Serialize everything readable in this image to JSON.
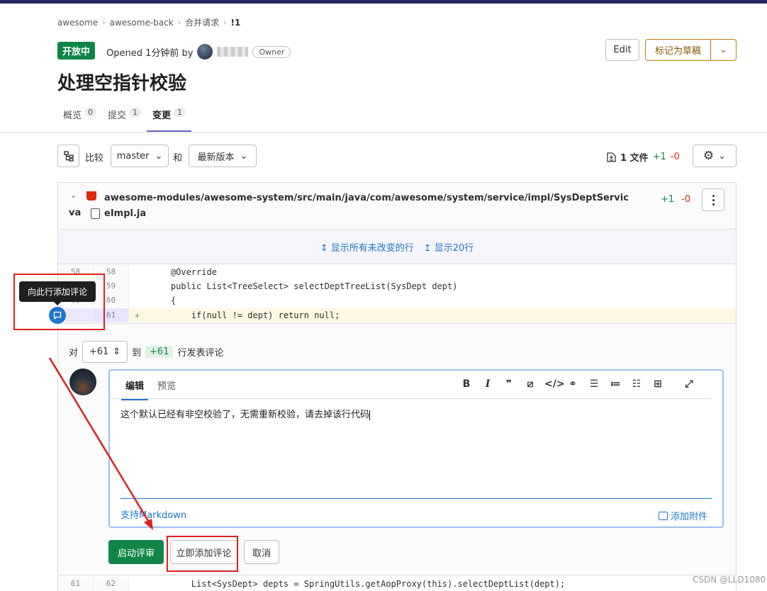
{
  "breadcrumb": [
    "awesome",
    "awesome-back",
    "合并请求",
    "!1"
  ],
  "status": "开放中",
  "opened_text": "Opened 1分钟前 by",
  "owner_badge": "Owner",
  "actions": {
    "edit": "Edit",
    "draft": "标记为草稿"
  },
  "title": "处理空指针校验",
  "tabs": [
    {
      "label": "概览",
      "count": "0"
    },
    {
      "label": "提交",
      "count": "1"
    },
    {
      "label": "变更",
      "count": "1"
    }
  ],
  "compare": {
    "label": "比较",
    "from": "master",
    "and": "和",
    "to": "最新版本"
  },
  "files": {
    "count_text": "1 文件",
    "added": "+1",
    "removed": "-0"
  },
  "file": {
    "path_line1": "awesome-modules/awesome-system/src/main/java/com/awesome/system/service/impl/SysDeptServiceImpl.ja",
    "path_line2": "va",
    "added": "+1",
    "removed": "-0"
  },
  "expand": {
    "all": "显示所有未改变的行",
    "twenty": "显示20行"
  },
  "code_lines": [
    {
      "old": "58",
      "new": "58",
      "prefix": "",
      "text": "    @Override"
    },
    {
      "old": "59",
      "new": "59",
      "prefix": "",
      "text": "    public List<TreeSelect> selectDeptTreeList(SysDept dept)"
    },
    {
      "old": "60",
      "new": "60",
      "prefix": "",
      "text": "    {"
    },
    {
      "old": "",
      "new": "61",
      "prefix": "+",
      "text": "        if(null != dept) return null;"
    },
    {
      "old": "61",
      "new": "62",
      "prefix": "",
      "text": "        List<SysDept> depts = SpringUtils.getAopProxy(this).selectDeptList(dept);"
    }
  ],
  "tooltip": "向此行添加评论",
  "comment": {
    "range_prefix": "对",
    "range_from": "+61",
    "range_mid": "到",
    "range_to": "+61",
    "range_suffix": "行发表评论",
    "tab_edit": "编辑",
    "tab_preview": "预览",
    "text": "这个默认已经有非空校验了，无需重新校验，请去掉该行代码",
    "markdown": "支持Markdown",
    "attach": "添加附件",
    "start_review": "启动评审",
    "add_now": "立即添加评论",
    "cancel": "取消"
  },
  "watermark": "CSDN @LLD1080",
  "colors": {
    "accent": "#1f75cb",
    "success": "#108548",
    "annotation": "#e02020",
    "draft": "#c17d10"
  }
}
